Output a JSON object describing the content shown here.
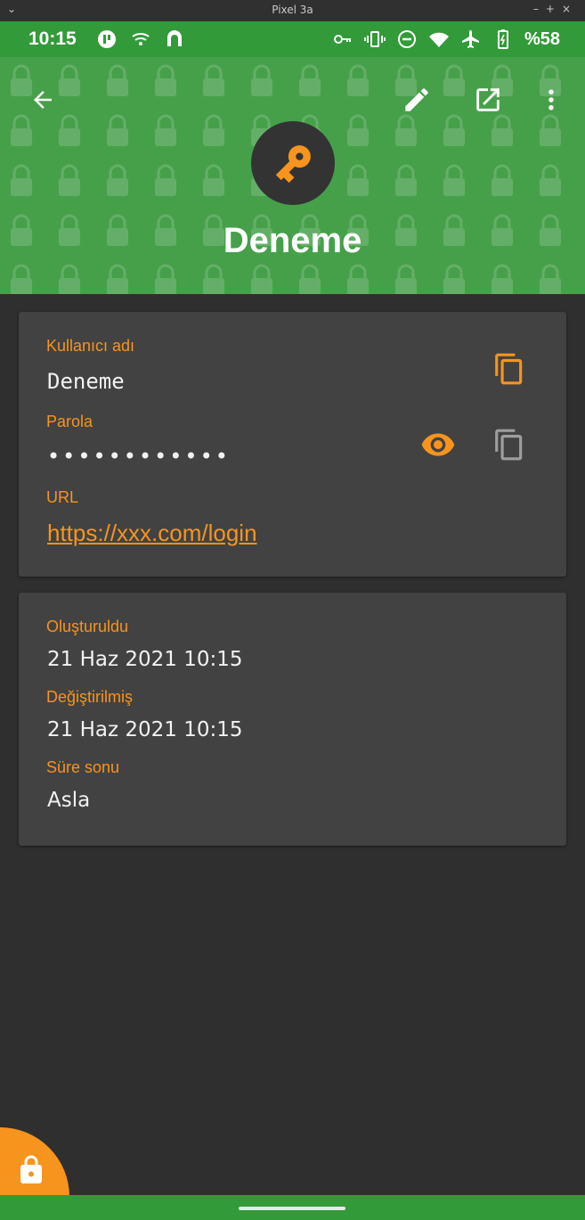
{
  "window": {
    "title": "Pixel 3a",
    "chevron": "⌄",
    "controls": "–+×"
  },
  "status_bar": {
    "time": "10:15",
    "battery_text": "%58",
    "left_icons": [
      "app-icon",
      "wifi-key-icon",
      "assistant-icon"
    ],
    "right_icons": [
      "vpn-key-icon",
      "vibrate-icon",
      "dnd-icon",
      "wifi-icon",
      "airplane-icon",
      "battery-icon"
    ]
  },
  "header": {
    "title": "Deneme",
    "back_icon": "arrow-back-icon",
    "edit_icon": "edit-icon",
    "open_icon": "open-external-icon",
    "menu_icon": "more-vert-icon",
    "avatar_icon": "key-icon"
  },
  "card_main": {
    "username_label": "Kullanıcı adı",
    "username_value": "Deneme",
    "password_label": "Parola",
    "password_value": "••••••••••••",
    "url_label": "URL",
    "url_value": "https://xxx.com/login"
  },
  "card_dates": {
    "created_label": "Oluşturuldu",
    "created_value": "21 Haz 2021 10:15",
    "modified_label": "Değiştirilmiş",
    "modified_value": "21 Haz 2021 10:15",
    "expiry_label": "Süre sonu",
    "expiry_value": "Asla"
  },
  "colors": {
    "accent": "#f7941d",
    "header_green": "#46a04a",
    "statusbar_green": "#339a3a",
    "background": "#2f2f2f",
    "card": "#424242"
  }
}
